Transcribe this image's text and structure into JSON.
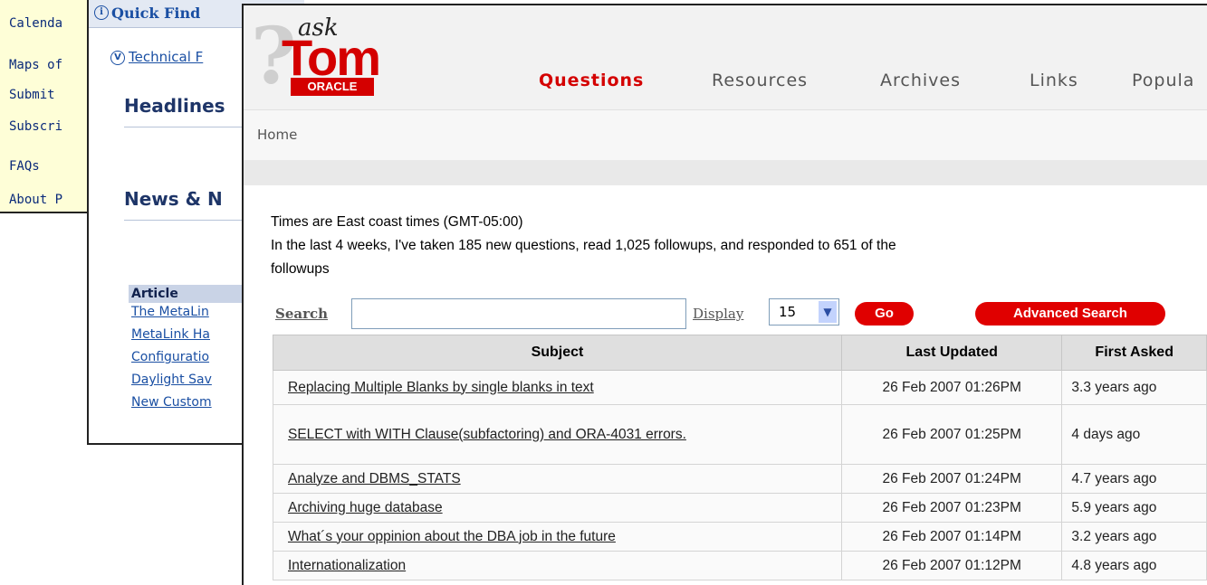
{
  "left_window": {
    "items": [
      "Calenda",
      "Maps of",
      "Submit",
      "Subscri",
      "FAQs",
      "About P"
    ]
  },
  "metalink_window": {
    "quick_find": "Quick Find",
    "technical_link": "Technical F",
    "headlines": "Headlines",
    "news": "News & N",
    "article_header": "Article",
    "articles": [
      "The MetaLin",
      "MetaLink Ha",
      "Configuratio",
      "Daylight Sav",
      "New Custom"
    ]
  },
  "asktom": {
    "logo": {
      "ask": "ask",
      "tom": "Tom",
      "oracle": "ORACLE"
    },
    "nav": {
      "questions": "Questions",
      "resources": "Resources",
      "archives": "Archives",
      "links": "Links",
      "popular": "Popula"
    },
    "breadcrumb": "Home",
    "info_line1": "Times are East coast times (GMT-05:00)",
    "info_line2": "In the last 4 weeks, I've taken 185 new questions, read 1,025 followups, and responded to 651 of the",
    "info_line3": "followups",
    "search_label": "Search",
    "search_value": "",
    "display_label": "Display",
    "display_value": "15",
    "go_button": "Go",
    "advanced_search_button": "Advanced Search",
    "table": {
      "headers": {
        "subject": "Subject",
        "last_updated": "Last Updated",
        "first_asked": "First Asked"
      },
      "rows": [
        {
          "subject": "Replacing Multiple Blanks by single blanks in text",
          "last_updated": "26 Feb 2007 01:26PM",
          "first_asked": "3.3 years ago"
        },
        {
          "subject": "SELECT with WITH Clause(subfactoring) and ORA-4031 errors.",
          "last_updated": "26 Feb 2007 01:25PM",
          "first_asked": "4 days ago"
        },
        {
          "subject": "Analyze and DBMS_STATS",
          "last_updated": "26 Feb 2007 01:24PM",
          "first_asked": "4.7 years ago"
        },
        {
          "subject": "Archiving huge database",
          "last_updated": "26 Feb 2007 01:23PM",
          "first_asked": "5.9 years ago"
        },
        {
          "subject": "What´s your oppinion about the DBA job in the future",
          "last_updated": "26 Feb 2007 01:14PM",
          "first_asked": "3.2 years ago"
        },
        {
          "subject": "Internationalization",
          "last_updated": "26 Feb 2007 01:12PM",
          "first_asked": "4.8 years ago"
        }
      ]
    }
  }
}
